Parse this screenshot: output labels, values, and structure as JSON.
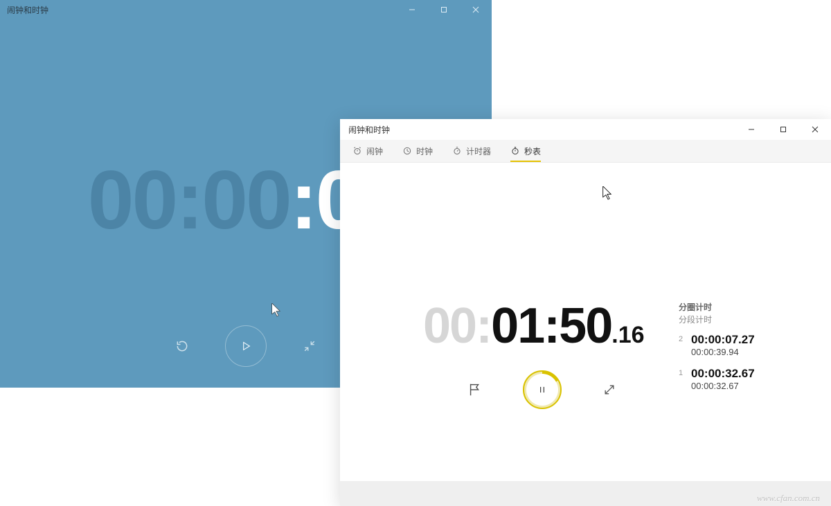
{
  "win1": {
    "title": "闹钟和时钟",
    "time_hours": "00",
    "time_minutes": "00",
    "time_seconds": "00"
  },
  "win2": {
    "title": "闹钟和时钟",
    "tabs": {
      "alarm": "闹钟",
      "clock": "时钟",
      "timer": "计时器",
      "stopwatch": "秒表"
    },
    "time_hours": "00",
    "time_minutes": "01",
    "time_seconds": "50",
    "time_cs": ".16",
    "lap_header1": "分圈计时",
    "lap_header2": "分段计时",
    "laps": [
      {
        "idx": "2",
        "lap": "00:00:07.27",
        "total": "00:00:39.94"
      },
      {
        "idx": "1",
        "lap": "00:00:32.67",
        "total": "00:00:32.67"
      }
    ]
  },
  "watermark": "www.cfan.com.cn"
}
